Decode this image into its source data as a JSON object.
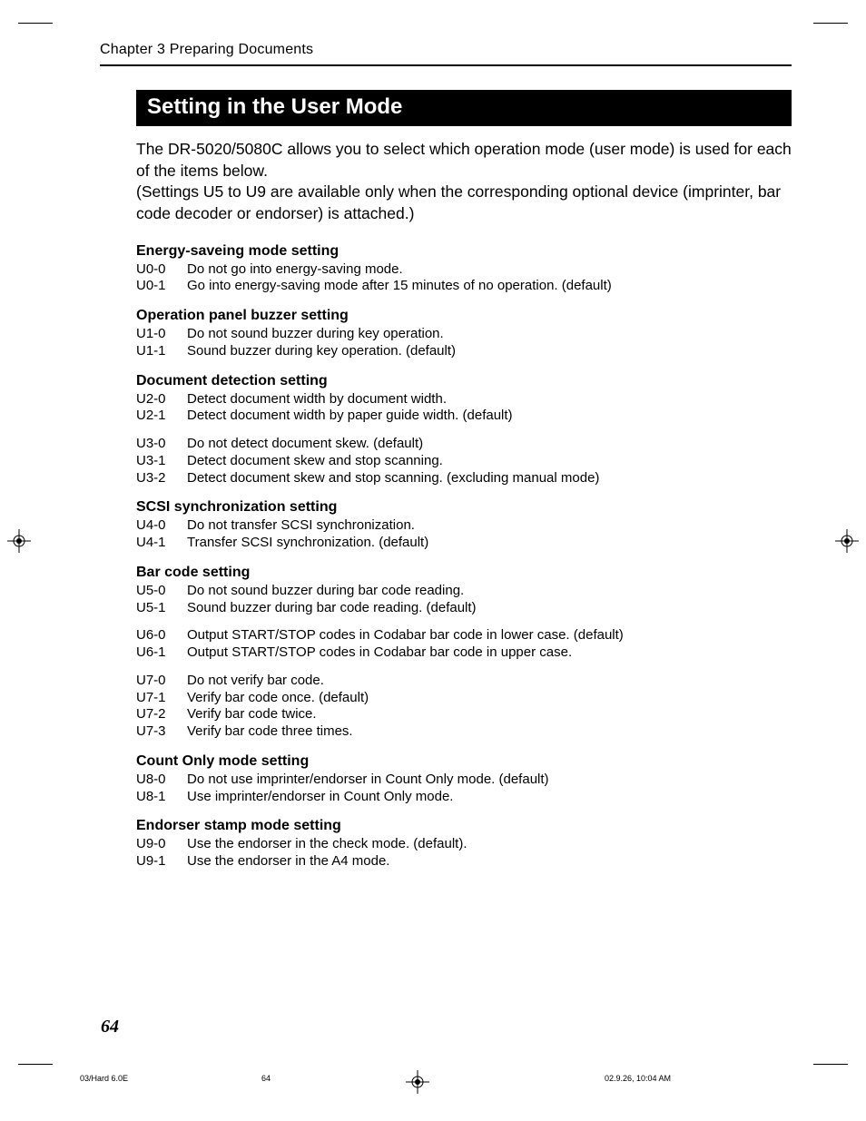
{
  "chapter": "Chapter 3    Preparing Documents",
  "banner": "Setting in the User Mode",
  "intro_1": "The DR-5020/5080C allows you to select which operation mode (user mode) is used for each of the items below.",
  "intro_2": "(Settings U5 to U9 are available only when the corresponding optional device (imprinter, bar code decoder or endorser) is attached.)",
  "sections": [
    {
      "title": "Energy-saveing mode setting",
      "blocks": [
        [
          {
            "code": "U0-0",
            "desc": "Do not go into energy-saving mode."
          },
          {
            "code": "U0-1",
            "desc": "Go into energy-saving mode after 15 minutes of no  operation. (default)"
          }
        ]
      ]
    },
    {
      "title": "Operation panel buzzer setting",
      "blocks": [
        [
          {
            "code": "U1-0",
            "desc": "Do not sound buzzer during key operation."
          },
          {
            "code": "U1-1",
            "desc": "Sound buzzer during key operation. (default)"
          }
        ]
      ]
    },
    {
      "title": "Document detection setting",
      "blocks": [
        [
          {
            "code": "U2-0",
            "desc": "Detect document width by document width."
          },
          {
            "code": "U2-1",
            "desc": "Detect document width by paper guide width. (default)"
          }
        ],
        [
          {
            "code": "U3-0",
            "desc": "Do not detect document skew. (default)"
          },
          {
            "code": "U3-1",
            "desc": "Detect document skew and stop scanning."
          },
          {
            "code": "U3-2",
            "desc": "Detect document skew and stop scanning. (excluding manual mode)"
          }
        ]
      ]
    },
    {
      "title": "SCSI synchronization setting",
      "blocks": [
        [
          {
            "code": "U4-0",
            "desc": "Do not transfer SCSI synchronization."
          },
          {
            "code": "U4-1",
            "desc": "Transfer SCSI synchronization. (default)"
          }
        ]
      ]
    },
    {
      "title": "Bar code setting",
      "blocks": [
        [
          {
            "code": "U5-0",
            "desc": "Do not sound buzzer during bar code reading."
          },
          {
            "code": "U5-1",
            "desc": "Sound buzzer during bar code reading. (default)"
          }
        ],
        [
          {
            "code": "U6-0",
            "desc": "Output START/STOP codes in Codabar bar code in lower case. (default)"
          },
          {
            "code": "U6-1",
            "desc": "Output START/STOP codes in Codabar bar code in upper case."
          }
        ],
        [
          {
            "code": "U7-0",
            "desc": "Do not verify bar code."
          },
          {
            "code": "U7-1",
            "desc": "Verify bar code once. (default)"
          },
          {
            "code": "U7-2",
            "desc": "Verify bar code twice."
          },
          {
            "code": "U7-3",
            "desc": "Verify bar code three times."
          }
        ]
      ]
    },
    {
      "title": "Count Only mode setting",
      "blocks": [
        [
          {
            "code": "U8-0",
            "desc": "Do not use imprinter/endorser in Count Only mode. (default)"
          },
          {
            "code": "U8-1",
            "desc": "Use imprinter/endorser in Count Only mode."
          }
        ]
      ]
    },
    {
      "title": "Endorser stamp mode setting",
      "blocks": [
        [
          {
            "code": "U9-0",
            "desc": "Use the endorser in the check mode. (default)."
          },
          {
            "code": "U9-1",
            "desc": "Use the endorser in the A4 mode."
          }
        ]
      ]
    }
  ],
  "page_number": "64",
  "footer_left": "03/Hard 6.0E",
  "footer_center": "64",
  "footer_right": "02.9.26, 10:04 AM"
}
